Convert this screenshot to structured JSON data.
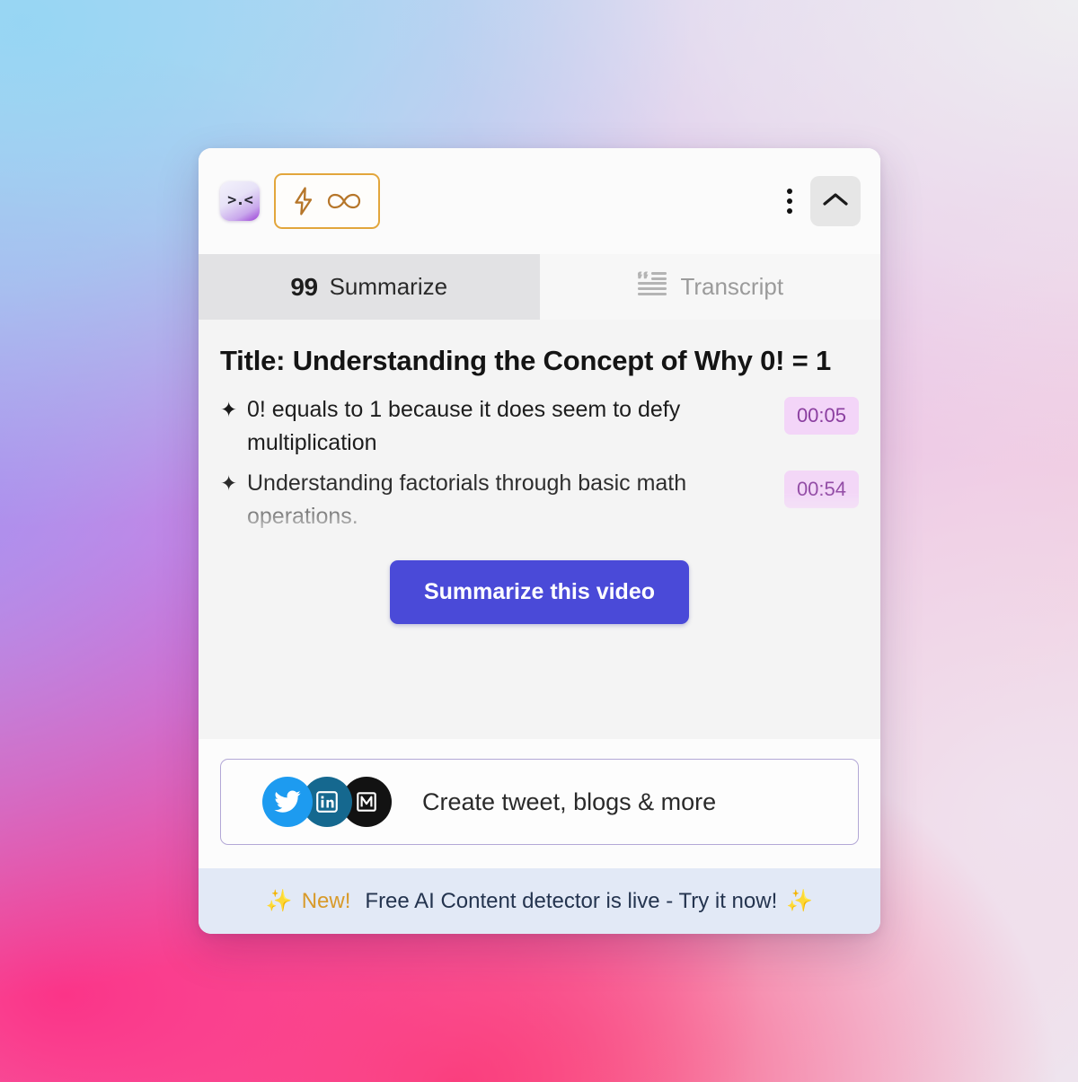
{
  "header": {
    "brand_logo": {
      "icon": "kawaii-face-logo",
      "face": ">.<"
    },
    "credit_pill": {
      "icon_lightning": "lightning-bolt-icon",
      "icon_infinity": "infinity-icon",
      "value": "∞"
    },
    "menu": {
      "icon": "kebab-menu-icon"
    },
    "collapse": {
      "icon": "chevron-up-icon"
    }
  },
  "tabs": [
    {
      "id": "summarize",
      "badge": "99",
      "label": "Summarize",
      "active": true
    },
    {
      "id": "transcript",
      "icon": "quote-list-icon",
      "label": "Transcript",
      "active": false
    }
  ],
  "summary": {
    "title": "Title: Understanding the Concept of Why 0! = 1",
    "bullets": [
      {
        "marker": "✦",
        "text": "0! equals to 1 because it does seem to defy multiplication",
        "timestamp": "00:05"
      },
      {
        "marker": "✦",
        "text": "Understanding factorials through basic math operations.",
        "timestamp": "00:54"
      }
    ],
    "cta_label": "Summarize this video"
  },
  "social": {
    "label": "Create tweet, blogs & more",
    "icons": [
      {
        "name": "twitter-icon",
        "color": "#1d9bf0"
      },
      {
        "name": "linkedin-icon",
        "color": "#15688f"
      },
      {
        "name": "medium-icon",
        "color": "#121212"
      }
    ]
  },
  "banner": {
    "spark_left": "✨",
    "new_label": "New!",
    "message": "Free AI Content detector is live - Try it now!",
    "spark_right": "✨"
  },
  "colors": {
    "accent_button": "#4a4ad8",
    "credit_border": "#e2a63c",
    "timestamp_bg": "#f3d5f8",
    "timestamp_text": "#8b3fa0",
    "banner_bg": "#e2e9f6",
    "social_border": "#b3a8d6",
    "active_tab_bg": "#e2e2e4"
  }
}
